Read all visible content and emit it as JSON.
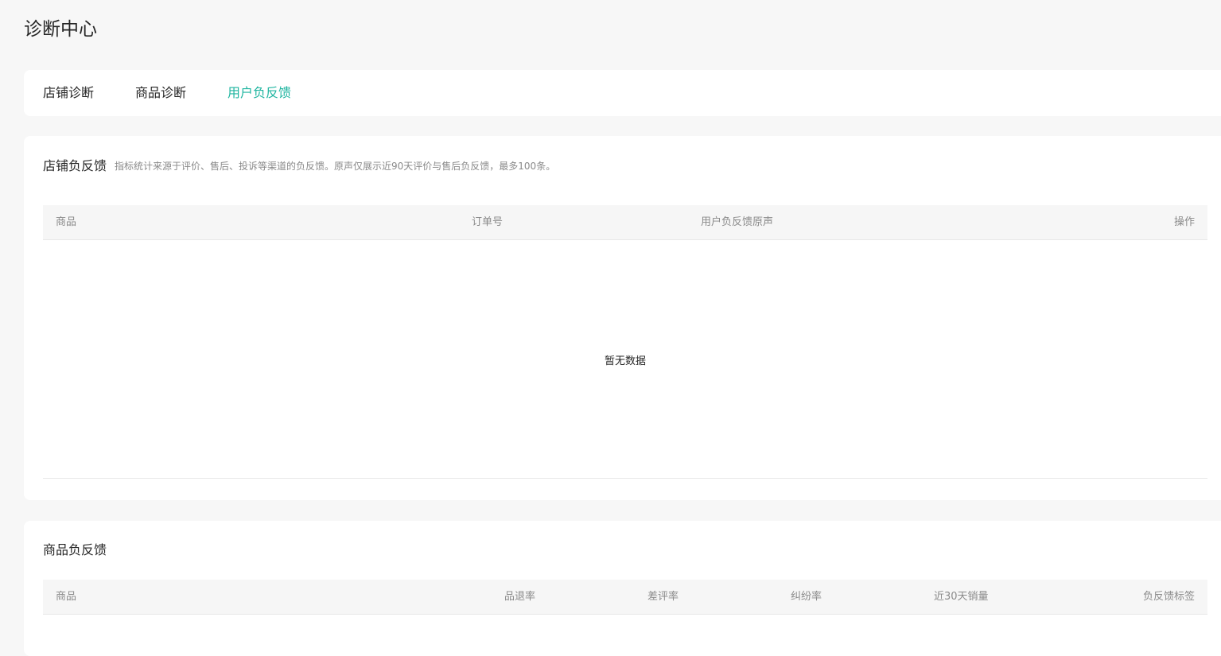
{
  "page": {
    "title": "诊断中心"
  },
  "tabs": [
    {
      "label": "店铺诊断",
      "active": false
    },
    {
      "label": "商品诊断",
      "active": false
    },
    {
      "label": "用户负反馈",
      "active": true
    }
  ],
  "store_feedback": {
    "title": "店铺负反馈",
    "description": "指标统计来源于评价、售后、投诉等渠道的负反馈。原声仅展示近90天评价与售后负反馈，最多100条。",
    "columns": [
      "商品",
      "订单号",
      "用户负反馈原声",
      "操作"
    ],
    "rows": [],
    "empty_text": "暂无数据"
  },
  "product_feedback": {
    "title": "商品负反馈",
    "columns": [
      "商品",
      "品退率",
      "差评率",
      "纠纷率",
      "近30天销量",
      "负反馈标签"
    ],
    "rows": []
  },
  "colors": {
    "accent": "#1fb5a0",
    "page_background": "#f7f7f7",
    "card_background": "#ffffff",
    "table_header_background": "#f6f6f6"
  }
}
